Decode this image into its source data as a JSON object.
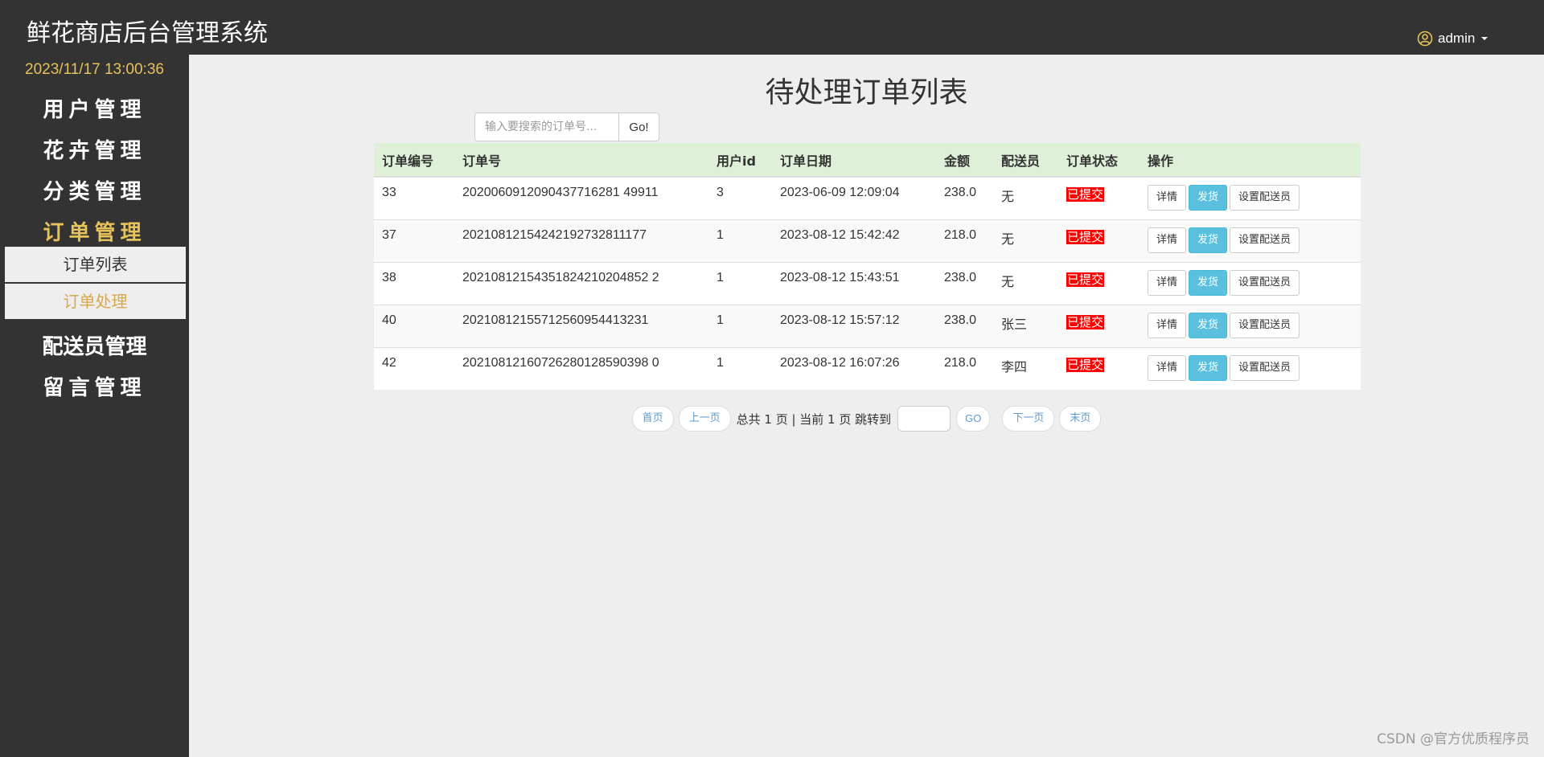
{
  "header": {
    "app_title": "鲜花商店后台管理系统",
    "username": "admin",
    "user_icon": "user-circle-icon"
  },
  "sidebar": {
    "clock": "2023/11/17 13:00:36",
    "items": [
      {
        "label": "用户管理"
      },
      {
        "label": "花卉管理"
      },
      {
        "label": "分类管理"
      },
      {
        "label": "订单管理"
      },
      {
        "label": "配送员管理"
      },
      {
        "label": "留言管理"
      }
    ],
    "subitems": [
      {
        "label": "订单列表"
      },
      {
        "label": "订单处理"
      }
    ]
  },
  "main": {
    "title": "待处理订单列表",
    "search": {
      "placeholder": "输入要搜索的订单号...",
      "button": "Go!"
    },
    "table": {
      "headers": [
        "订单编号",
        "订单号",
        "用户id",
        "订单日期",
        "金额",
        "配送员",
        "订单状态",
        "操作"
      ],
      "rows": [
        {
          "id": "33",
          "order_no": "2020060912090437716281 49911",
          "user_id": "3",
          "date": "2023-06-09 12:09:04",
          "amount": "238.0",
          "courier": "无",
          "status": "已提交"
        },
        {
          "id": "37",
          "order_no": "20210812154242192732811177",
          "user_id": "1",
          "date": "2023-08-12 15:42:42",
          "amount": "218.0",
          "courier": "无",
          "status": "已提交"
        },
        {
          "id": "38",
          "order_no": "20210812154351824210204852 2",
          "user_id": "1",
          "date": "2023-08-12 15:43:51",
          "amount": "238.0",
          "courier": "无",
          "status": "已提交"
        },
        {
          "id": "40",
          "order_no": "20210812155712560954413231",
          "user_id": "1",
          "date": "2023-08-12 15:57:12",
          "amount": "238.0",
          "courier": "张三",
          "status": "已提交"
        },
        {
          "id": "42",
          "order_no": "20210812160726280128590398 0",
          "user_id": "1",
          "date": "2023-08-12 16:07:26",
          "amount": "218.0",
          "courier": "李四",
          "status": "已提交"
        }
      ],
      "actions": {
        "detail": "详情",
        "ship": "发货",
        "set_courier": "设置配送员"
      },
      "colors": {
        "header_bg": "#dff0d8",
        "status_bg": "#ff0000",
        "ship_btn": "#5bc0de"
      }
    },
    "pagination": {
      "first": "首页",
      "prev": "上一页",
      "info": "总共 1 页 | 当前 1 页 跳转到",
      "go": "GO",
      "next": "下一页",
      "last": "末页"
    }
  },
  "watermark": "CSDN @官方优质程序员"
}
